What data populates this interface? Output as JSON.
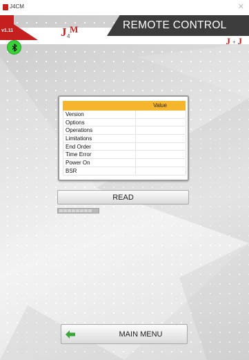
{
  "window": {
    "title": "J4CM",
    "icon": "app-icon",
    "close_icon": "close-icon"
  },
  "header": {
    "version": "v1.11",
    "title": "REMOTE CONTROL",
    "logo_left": "J4M",
    "logo_right": "J + J",
    "accent_color": "#c61f1f",
    "band_color": "#3c3c3c"
  },
  "bluetooth": {
    "icon": "bluetooth-icon",
    "status_color": "#39d13a"
  },
  "table": {
    "header_color": "#f5b52d",
    "columns": [
      "",
      "Value"
    ],
    "rows": [
      {
        "parameter": "Version",
        "value": ""
      },
      {
        "parameter": "Options",
        "value": ""
      },
      {
        "parameter": "Operations",
        "value": ""
      },
      {
        "parameter": "Limitations",
        "value": ""
      },
      {
        "parameter": "End Order",
        "value": ""
      },
      {
        "parameter": "Time Error",
        "value": ""
      },
      {
        "parameter": "Power On",
        "value": ""
      },
      {
        "parameter": "BSR",
        "value": ""
      }
    ]
  },
  "read_button": {
    "label": "READ"
  },
  "main_menu_button": {
    "label": "MAIN MENU",
    "icon": "arrow-left-icon",
    "icon_color": "#3aa53a"
  }
}
